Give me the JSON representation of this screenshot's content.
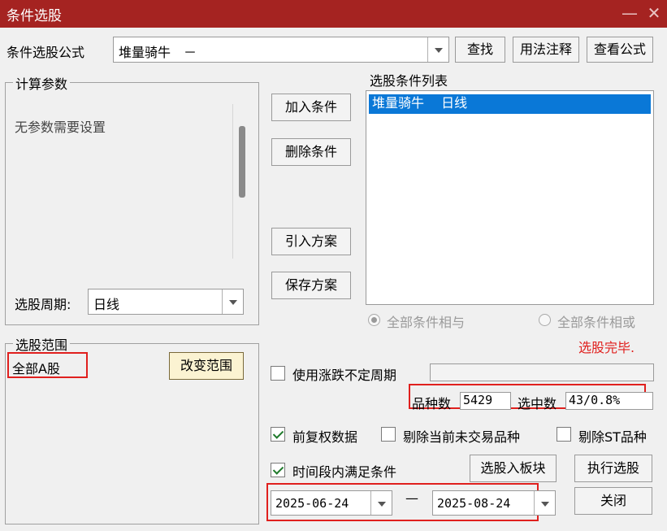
{
  "window": {
    "title": "条件选股",
    "minimize_glyph": "—",
    "close_glyph": "✕"
  },
  "formula": {
    "label": "条件选股公式",
    "value": "堆量骑牛　－",
    "find_button": "查找",
    "usage_button": "用法注释",
    "view_button": "查看公式"
  },
  "params": {
    "group_label": "计算参数",
    "note": "无参数需要设置",
    "period_label": "选股周期:",
    "period_value": "日线"
  },
  "actions": {
    "add": "加入条件",
    "delete": "删除条件",
    "import": "引入方案",
    "save": "保存方案"
  },
  "condition_list": {
    "label": "选股条件列表",
    "items": [
      {
        "name": "堆量骑牛",
        "period": "日线",
        "selected": true
      }
    ]
  },
  "logic": {
    "and_label": "全部条件相与",
    "or_label": "全部条件相或",
    "selected": "and"
  },
  "status": {
    "message": "选股完毕.",
    "color": "#e0201e"
  },
  "range": {
    "group_label": "选股范围",
    "value": "全部A股",
    "change_button": "改变范围"
  },
  "options": {
    "use_irregular_period": {
      "label": "使用涨跌不定周期",
      "checked": false
    },
    "forward_adjust": {
      "label": "前复权数据",
      "checked": true
    },
    "exclude_not_trading": {
      "label": "剔除当前未交易品种",
      "checked": false
    },
    "exclude_st": {
      "label": "剔除ST品种",
      "checked": false
    },
    "time_range": {
      "label": "时间段内满足条件",
      "checked": true
    }
  },
  "stats": {
    "count_label": "品种数",
    "count_value": "5429",
    "selected_label": "选中数",
    "selected_value": "43/0.8%"
  },
  "dates": {
    "start": "2025-06-24",
    "separator": "—",
    "end": "2025-08-24"
  },
  "buttons": {
    "to_block": "选股入板块",
    "execute": "执行选股",
    "close": "关闭"
  }
}
